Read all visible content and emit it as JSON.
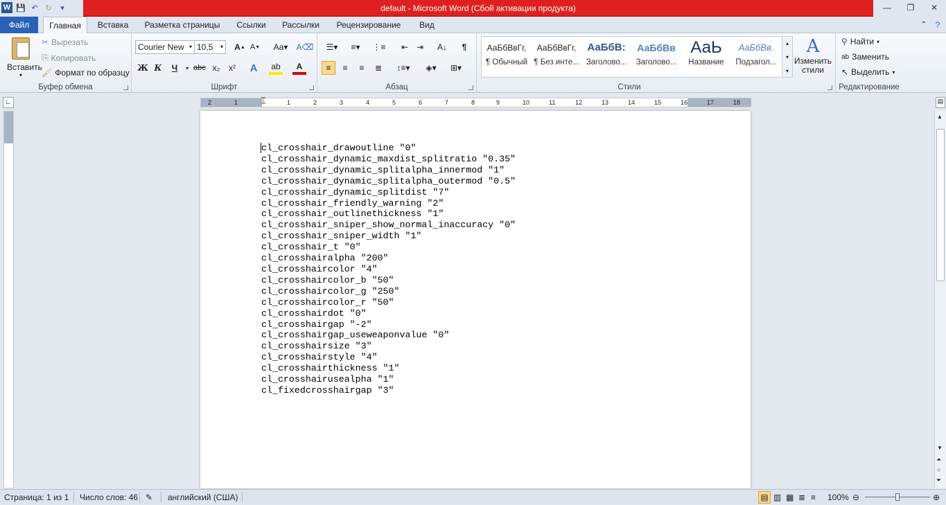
{
  "window": {
    "title": "default  -  Microsoft Word (Сбой активации продукта)"
  },
  "tabs": [
    {
      "label": "Файл"
    },
    {
      "label": "Главная"
    },
    {
      "label": "Вставка"
    },
    {
      "label": "Разметка страницы"
    },
    {
      "label": "Ссылки"
    },
    {
      "label": "Рассылки"
    },
    {
      "label": "Рецензирование"
    },
    {
      "label": "Вид"
    }
  ],
  "clipboard": {
    "paste": "Вставить",
    "cut": "Вырезать",
    "copy": "Копировать",
    "format_painter": "Формат по образцу",
    "label": "Буфер обмена"
  },
  "font": {
    "family": "Courier New",
    "size": "10,5",
    "label": "Шрифт",
    "bold": "Ж",
    "italic": "К",
    "underline": "Ч",
    "strike": "abc",
    "sub": "x₂",
    "sup": "x²"
  },
  "paragraph": {
    "label": "Абзац"
  },
  "styles": {
    "label": "Стили",
    "items": [
      {
        "sample": "АаБбВвГг,",
        "name": "¶ Обычный"
      },
      {
        "sample": "АаБбВвГг,",
        "name": "¶ Без инте..."
      },
      {
        "sample": "АаБбВ:",
        "name": "Заголово..."
      },
      {
        "sample": "АаБбВв",
        "name": "Заголово..."
      },
      {
        "sample": "АаЬ",
        "name": "Название"
      },
      {
        "sample": "АаБбВв.",
        "name": "Подзагол..."
      }
    ],
    "change": "Изменить стили"
  },
  "editing": {
    "find": "Найти",
    "replace": "Заменить",
    "select": "Выделить",
    "label": "Редактирование"
  },
  "ruler": {
    "numbers": [
      "2",
      "1",
      "1",
      "2",
      "3",
      "4",
      "5",
      "6",
      "7",
      "8",
      "9",
      "10",
      "11",
      "12",
      "13",
      "14",
      "15",
      "16",
      "17",
      "18"
    ]
  },
  "document": {
    "lines": [
      "cl_crosshair_drawoutline \"0\"",
      "cl_crosshair_dynamic_maxdist_splitratio \"0.35\"",
      "cl_crosshair_dynamic_splitalpha_innermod \"1\"",
      "cl_crosshair_dynamic_splitalpha_outermod \"0.5\"",
      "cl_crosshair_dynamic_splitdist \"7\"",
      "cl_crosshair_friendly_warning \"2\"",
      "cl_crosshair_outlinethickness \"1\"",
      "cl_crosshair_sniper_show_normal_inaccuracy \"0\"",
      "cl_crosshair_sniper_width \"1\"",
      "cl_crosshair_t \"0\"",
      "cl_crosshairalpha \"200\"",
      "cl_crosshaircolor \"4\"",
      "cl_crosshaircolor_b \"50\"",
      "cl_crosshaircolor_g \"250\"",
      "cl_crosshaircolor_r \"50\"",
      "cl_crosshairdot \"0\"",
      "cl_crosshairgap \"-2\"",
      "cl_crosshairgap_useweaponvalue \"0\"",
      "cl_crosshairsize \"3\"",
      "cl_crosshairstyle \"4\"",
      "cl_crosshairthickness \"1\"",
      "cl_crosshairusealpha \"1\"",
      "cl_fixedcrosshairgap \"3\""
    ]
  },
  "status": {
    "page": "Страница: 1 из 1",
    "words": "Число слов: 46",
    "language": "английский (США)",
    "zoom": "100%"
  },
  "colors": {
    "title_bar": "#e02020",
    "file_tab": "#2a62b5"
  }
}
